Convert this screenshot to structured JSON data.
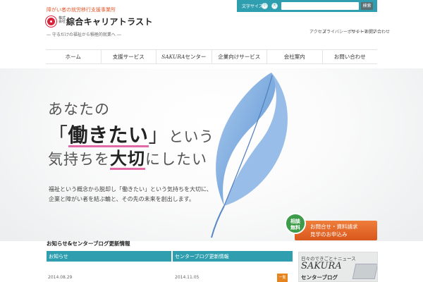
{
  "header": {
    "tagline": "障がい者の就労移行支援事業所",
    "logo_kabu": "株式会社",
    "logo_name": "綜合キャリアトラスト",
    "logo_sub": "― 守るだけの福祉から積極的就業へ ―"
  },
  "topbar": {
    "label": "文字サイズ",
    "size_small": "小",
    "size_large": "大",
    "search_placeholder": "",
    "search_button": "検索"
  },
  "sublinks": [
    "アクセス",
    "プライバシーポリシー",
    "サイトマップ",
    "お問い合わせ"
  ],
  "nav": {
    "items": [
      "ホーム",
      "支援サービス",
      "センター",
      "企業向けサービス",
      "会社案内",
      "お問い合わせ"
    ],
    "sakura_prefix": "SAKURA"
  },
  "hero": {
    "line1": "あなたの",
    "line2_open": "「",
    "line2_big": "働きたい",
    "line2_close": "」",
    "line2_rest": "という",
    "line3_pre": "気持ちを",
    "line3_big": "大切",
    "line3_post": "にしたい",
    "desc1": "福祉という概念から脱却し「働きたい」という気持ちを大切に、",
    "desc2": "企業と障がい者を結ぶ輪と、その先の未来を創出します。"
  },
  "cta": {
    "badge": "相談\n無料",
    "line1": "お問合せ・資料請求",
    "line2": "見学のお申込み"
  },
  "news": {
    "title": "お知らせ&センターブログ更新情報",
    "col1_header": "お知らせ",
    "col2_header": "センターブログ更新情報",
    "date1": "2014.08.29",
    "date2": "2014.11.05",
    "more": "一覧"
  },
  "blog_banner": {
    "line1": "日々のできごと＋ニュース",
    "sakura": "SAKURA",
    "line3": "センターブログ"
  },
  "colors": {
    "accent_teal": "#2f9fb0",
    "cta_orange": "#e26b27",
    "highlight_pink": "#e26aa6",
    "feather_blue": "#6a9ed8"
  }
}
